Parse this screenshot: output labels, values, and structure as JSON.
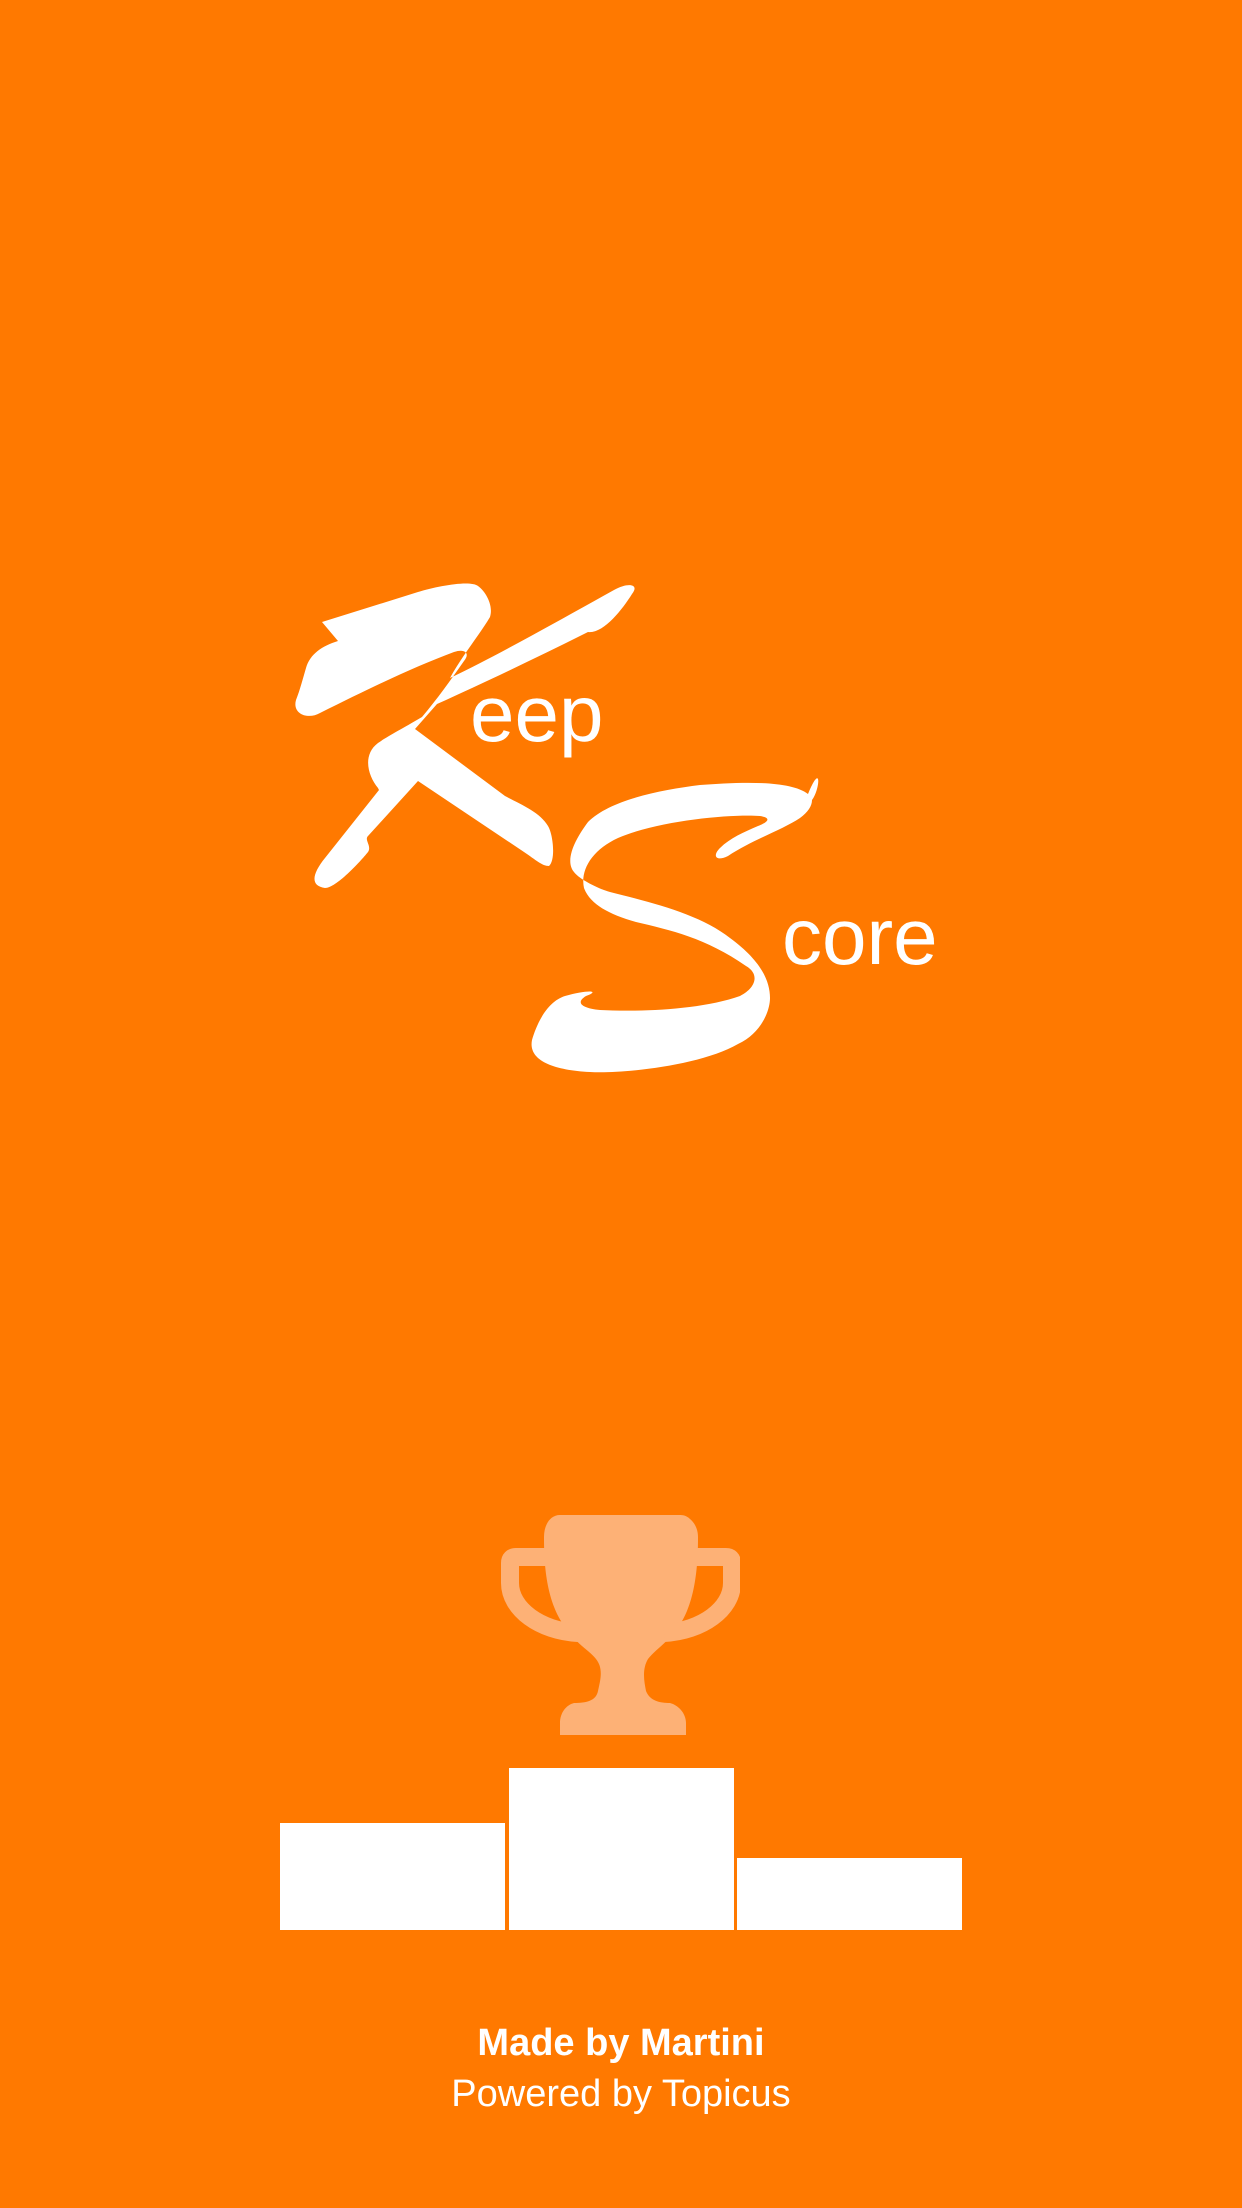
{
  "colors": {
    "background": "#FF7900",
    "foreground": "#FFFFFF",
    "trophy": "#FDB176"
  },
  "logo": {
    "word1_initial": "K",
    "word1_rest": "eep",
    "word2_initial": "S",
    "word2_rest": "core"
  },
  "illustration": {
    "trophy_icon": "trophy-icon",
    "podium_icon": "podium-icon"
  },
  "credits": {
    "made_by": "Made by Martini",
    "powered_by": "Powered by Topicus"
  }
}
